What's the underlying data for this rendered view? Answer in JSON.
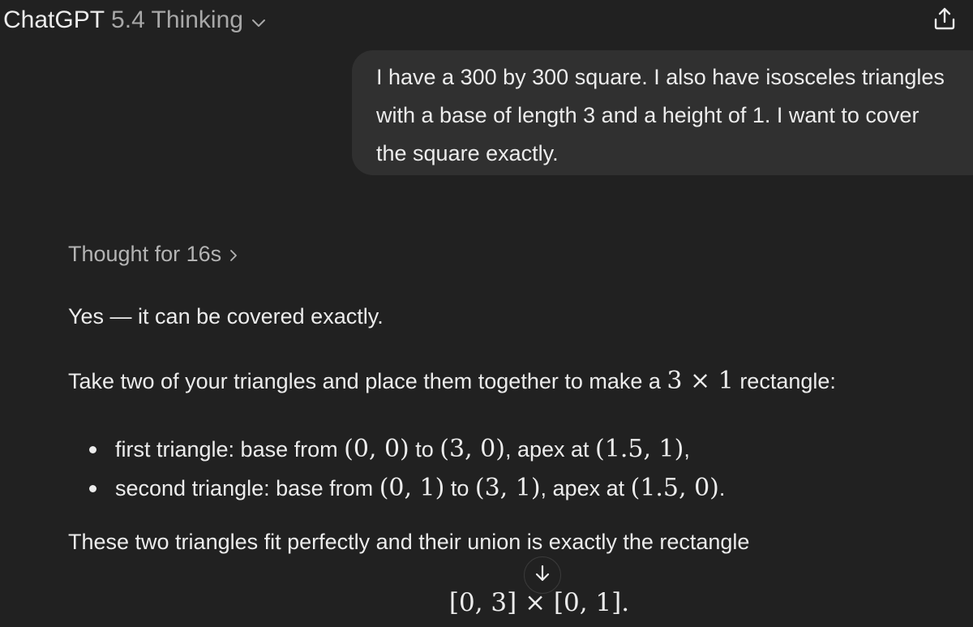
{
  "header": {
    "model_name": "ChatGPT",
    "model_version": "5.4 Thinking",
    "dropdown_icon": "chevron-down-icon",
    "share_icon": "share-icon"
  },
  "user_message": {
    "lines": [
      "I have a 300 by 300 square. I also have isosceles triangles",
      "with a base of length 3 and a height of 1. I want to cover",
      "the square exactly."
    ]
  },
  "assistant": {
    "thought_label": "Thought for 16s",
    "thought_icon": "chevron-right-icon",
    "p1": "Yes — it can be covered exactly.",
    "p2_before": "Take two of your triangles and place them together to make a ",
    "p2_math": "3 × 1",
    "p2_after": " rectangle:",
    "bullets": [
      {
        "t1": "first triangle: base from ",
        "m1": "(0, 0)",
        "t2": " to ",
        "m2": "(3, 0)",
        "t3": ", apex at ",
        "m3": "(1.5, 1)",
        "t4": ","
      },
      {
        "t1": "second triangle: base from ",
        "m1": "(0, 1)",
        "t2": " to ",
        "m2": "(3, 1)",
        "t3": ", apex at ",
        "m3": "(1.5, 0)",
        "t4": "."
      }
    ],
    "p3": "These two triangles fit perfectly and their union is exactly the rectangle",
    "display_math": "[0, 3] × [0, 1]."
  },
  "scroll_down_icon": "arrow-down-icon",
  "colors": {
    "background": "#212121",
    "bubble": "#303030",
    "text": "#ececec",
    "muted": "#b4b4b4"
  }
}
